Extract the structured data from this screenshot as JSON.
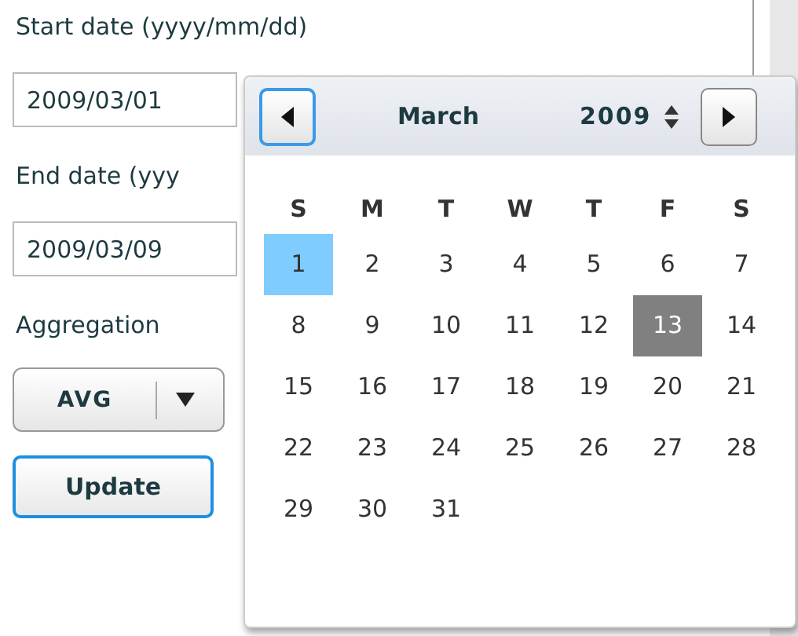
{
  "form": {
    "start_label": "Start date (yyyy/mm/dd)",
    "start_value": "2009/03/01",
    "end_label": "End date (yyy",
    "end_value": "2009/03/09",
    "aggregation_label": "Aggregation",
    "aggregation_value": "AVG",
    "update_button": "Update"
  },
  "calendar": {
    "month": "March",
    "year": "2009",
    "weekdays": [
      "S",
      "M",
      "T",
      "W",
      "T",
      "F",
      "S"
    ],
    "days": [
      {
        "label": "1",
        "selected": true,
        "today": false
      },
      {
        "label": "2",
        "selected": false,
        "today": false
      },
      {
        "label": "3",
        "selected": false,
        "today": false
      },
      {
        "label": "4",
        "selected": false,
        "today": false
      },
      {
        "label": "5",
        "selected": false,
        "today": false
      },
      {
        "label": "6",
        "selected": false,
        "today": false
      },
      {
        "label": "7",
        "selected": false,
        "today": false
      },
      {
        "label": "8",
        "selected": false,
        "today": false
      },
      {
        "label": "9",
        "selected": false,
        "today": false
      },
      {
        "label": "10",
        "selected": false,
        "today": false
      },
      {
        "label": "11",
        "selected": false,
        "today": false
      },
      {
        "label": "12",
        "selected": false,
        "today": false
      },
      {
        "label": "13",
        "selected": false,
        "today": true
      },
      {
        "label": "14",
        "selected": false,
        "today": false
      },
      {
        "label": "15",
        "selected": false,
        "today": false
      },
      {
        "label": "16",
        "selected": false,
        "today": false
      },
      {
        "label": "17",
        "selected": false,
        "today": false
      },
      {
        "label": "18",
        "selected": false,
        "today": false
      },
      {
        "label": "19",
        "selected": false,
        "today": false
      },
      {
        "label": "20",
        "selected": false,
        "today": false
      },
      {
        "label": "21",
        "selected": false,
        "today": false
      },
      {
        "label": "22",
        "selected": false,
        "today": false
      },
      {
        "label": "23",
        "selected": false,
        "today": false
      },
      {
        "label": "24",
        "selected": false,
        "today": false
      },
      {
        "label": "25",
        "selected": false,
        "today": false
      },
      {
        "label": "26",
        "selected": false,
        "today": false
      },
      {
        "label": "27",
        "selected": false,
        "today": false
      },
      {
        "label": "28",
        "selected": false,
        "today": false
      },
      {
        "label": "29",
        "selected": false,
        "today": false
      },
      {
        "label": "30",
        "selected": false,
        "today": false
      },
      {
        "label": "31",
        "selected": false,
        "today": false
      }
    ]
  }
}
